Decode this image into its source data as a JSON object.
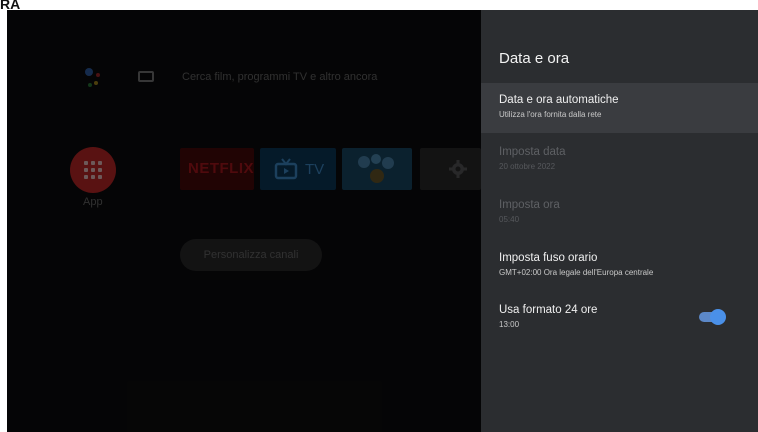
{
  "corner_label": "RA",
  "home": {
    "search_placeholder": "Cerca film, programmi TV e altro ancora",
    "apps_label": "App",
    "tiles": {
      "netflix_label": "NETFLIX",
      "tv_label": "TV"
    },
    "customize_channels_label": "Personalizza canali"
  },
  "panel": {
    "title": "Data e ora",
    "rows": [
      {
        "title": "Data e ora automatiche",
        "subtitle": "Utilizza l'ora fornita dalla rete"
      },
      {
        "title": "Imposta data",
        "subtitle": "20 ottobre 2022"
      },
      {
        "title": "Imposta ora",
        "subtitle": "05:40"
      },
      {
        "title": "Imposta fuso orario",
        "subtitle": "GMT+02:00 Ora legale dell'Europa centrale"
      },
      {
        "title": "Usa formato 24 ore",
        "subtitle": "13:00"
      }
    ],
    "toggle_24h_on": true
  },
  "colors": {
    "panel_bg": "#2b2d30",
    "selected_row": "#3a3c40",
    "toggle_accent": "#4a90e8",
    "netflix_red": "#b0171d"
  }
}
